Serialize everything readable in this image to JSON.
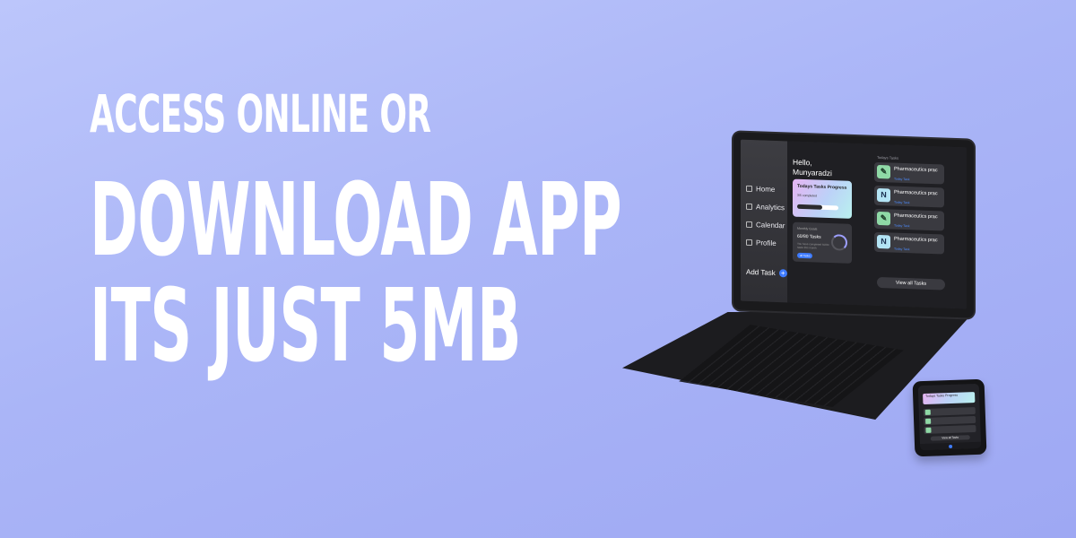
{
  "headline": {
    "line1": "ACCESS ONLINE OR",
    "line2": "DOWNLOAD APP",
    "line3": "ITS JUST 5MB"
  },
  "laptop_app": {
    "sidebar": {
      "items": [
        {
          "label": "Home",
          "icon": "home-icon"
        },
        {
          "label": "Analytics",
          "icon": "analytics-icon"
        },
        {
          "label": "Calendar",
          "icon": "calendar-icon"
        },
        {
          "label": "Profile",
          "icon": "profile-icon"
        }
      ],
      "add_task_label": "Add Task",
      "add_task_icon": "+"
    },
    "greeting_line1": "Hello,",
    "greeting_line2": "Munyaradzi",
    "progress_card": {
      "title": "Todays Tasks Progress",
      "subtitle": "3/5 completed",
      "progress": 0.6
    },
    "stats_card": {
      "label": "Monthly Goals",
      "value": "60/80 Tasks",
      "note": "You have completed 60/80 tasks this month",
      "pill": "all Tasks"
    },
    "today_tasks_label": "Todays Tasks",
    "tasks": [
      {
        "title": "Pharmaceutics prac",
        "link": "Today Task",
        "icon": "leaf-icon",
        "glyph": "✎"
      },
      {
        "title": "Pharmaceutics prac",
        "link": "Today Task",
        "icon": "n-icon",
        "glyph": "N"
      },
      {
        "title": "Pharmaceutics prac",
        "link": "Today Task",
        "icon": "leaf-icon",
        "glyph": "✎"
      },
      {
        "title": "Pharmaceutics prac",
        "link": "Today Task",
        "icon": "n-icon",
        "glyph": "N"
      }
    ],
    "view_all_label": "View all Tasks"
  },
  "phone_app": {
    "card_title": "Todays Tasks Progress",
    "view_all_label": "View all Tasks"
  },
  "colors": {
    "accent": "#3e7bff",
    "background": "#aab5f7"
  }
}
